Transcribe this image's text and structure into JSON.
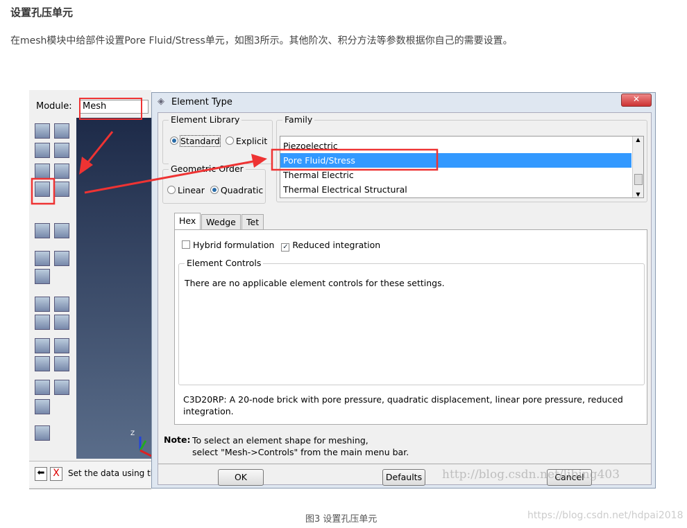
{
  "heading": "设置孔压单元",
  "paragraph": "在mesh模块中给部件设置Pore Fluid/Stress单元，如图3所示。其他阶次、积分方法等参数根据你自己的需要设置。",
  "caption": "图3 设置孔压单元",
  "watermark": "https://blog.csdn.net/hdpai2018",
  "watermark2": "http://blog.csdn.net/libing403",
  "abaqus": {
    "module_label": "Module:",
    "module_value": "Mesh",
    "prompt": "Set the data using th"
  },
  "dialog": {
    "title": "Element Type",
    "element_library": {
      "label": "Element Library",
      "options": [
        "Standard",
        "Explicit"
      ],
      "selected": "Standard"
    },
    "geometric_order": {
      "label": "Geometric Order",
      "options": [
        "Linear",
        "Quadratic"
      ],
      "selected": "Quadratic"
    },
    "family": {
      "label": "Family",
      "items": [
        "Piezoelectric",
        "Pore Fluid/Stress",
        "Thermal Electric",
        "Thermal Electrical Structural"
      ],
      "selected": "Pore Fluid/Stress"
    },
    "tabs": [
      "Hex",
      "Wedge",
      "Tet"
    ],
    "active_tab": "Hex",
    "hybrid": {
      "label": "Hybrid formulation",
      "checked": false
    },
    "reduced": {
      "label": "Reduced integration",
      "checked": true
    },
    "element_controls": {
      "label": "Element Controls",
      "message": "There are no applicable element controls for these settings."
    },
    "description": "C3D20RP:  A 20-node brick with pore pressure, quadratic displacement, linear pore pressure, reduced integration.",
    "note_label": "Note:",
    "note_line1": "To select an element shape for meshing,",
    "note_line2": "select \"Mesh->Controls\" from the main menu bar.",
    "buttons": {
      "ok": "OK",
      "defaults": "Defaults",
      "cancel": "Cancel"
    }
  },
  "colors": {
    "selection": "#3399ff",
    "annotation": "#ee3333"
  }
}
